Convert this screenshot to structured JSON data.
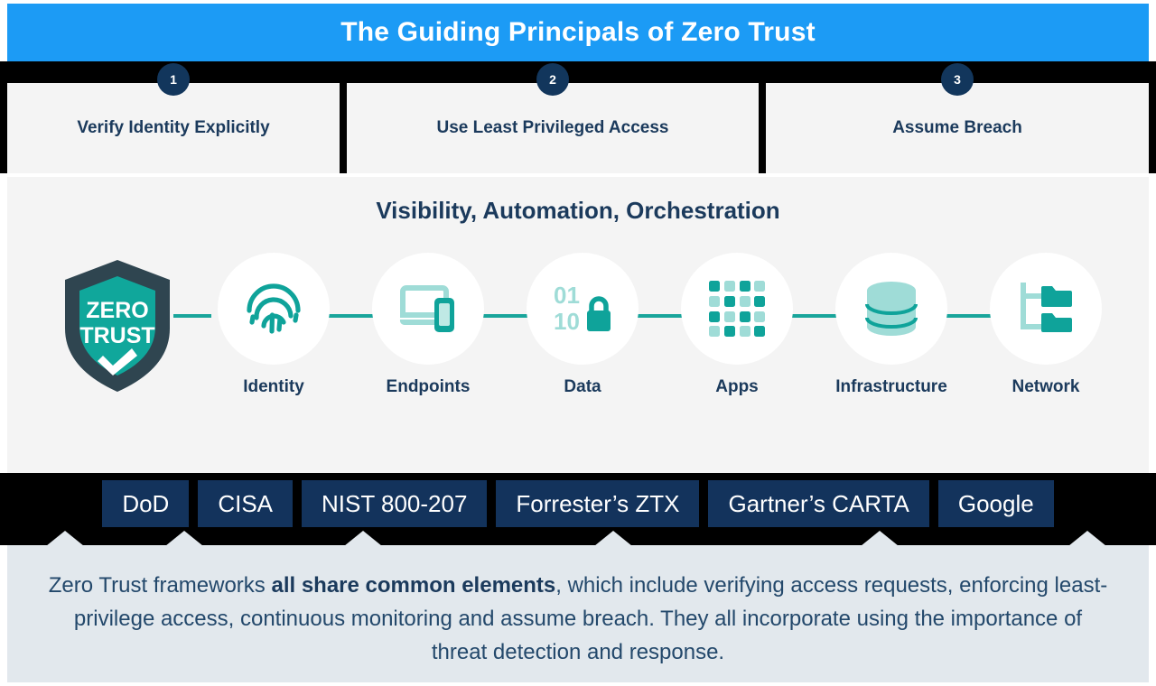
{
  "header": {
    "title": "The Guiding Principals of Zero Trust",
    "background": "#1c9bf5",
    "text_color": "#ffffff"
  },
  "principles": [
    {
      "number": "1",
      "label": "Verify Identity Explicitly"
    },
    {
      "number": "2",
      "label": "Use Least Privileged Access"
    },
    {
      "number": "3",
      "label": "Assume Breach"
    }
  ],
  "main": {
    "section_title": "Visibility, Automation, Orchestration",
    "shield": {
      "line1": "ZERO",
      "line2": "TRUST",
      "icon": "shield-check-icon",
      "outer_color": "#2f4550",
      "inner_color": "#10a79b"
    },
    "pillars": [
      {
        "label": "Identity",
        "icon": "fingerprint-icon"
      },
      {
        "label": "Endpoints",
        "icon": "devices-icon"
      },
      {
        "label": "Data",
        "icon": "binary-lock-icon"
      },
      {
        "label": "Apps",
        "icon": "app-grid-icon"
      },
      {
        "label": "Infrastructure",
        "icon": "database-icon"
      },
      {
        "label": "Network",
        "icon": "network-folders-icon"
      }
    ],
    "accent_dark": "#0fa39a",
    "accent_light": "#9fdcd7",
    "connector_color": "#19a59b"
  },
  "frameworks": [
    {
      "label": "DoD"
    },
    {
      "label": "CISA"
    },
    {
      "label": "NIST 800-207"
    },
    {
      "label": "Forrester’s ZTX"
    },
    {
      "label": "Gartner’s CARTA"
    },
    {
      "label": "Google"
    }
  ],
  "summary": {
    "part1": "Zero Trust frameworks ",
    "bold": "all share common elements",
    "part2": ", which include verifying access requests, enforcing least-privilege access, continuous monitoring and assume breach. They all incorporate using the importance of threat detection and response.",
    "background": "#e2e8ed",
    "text_color": "#23486b"
  }
}
